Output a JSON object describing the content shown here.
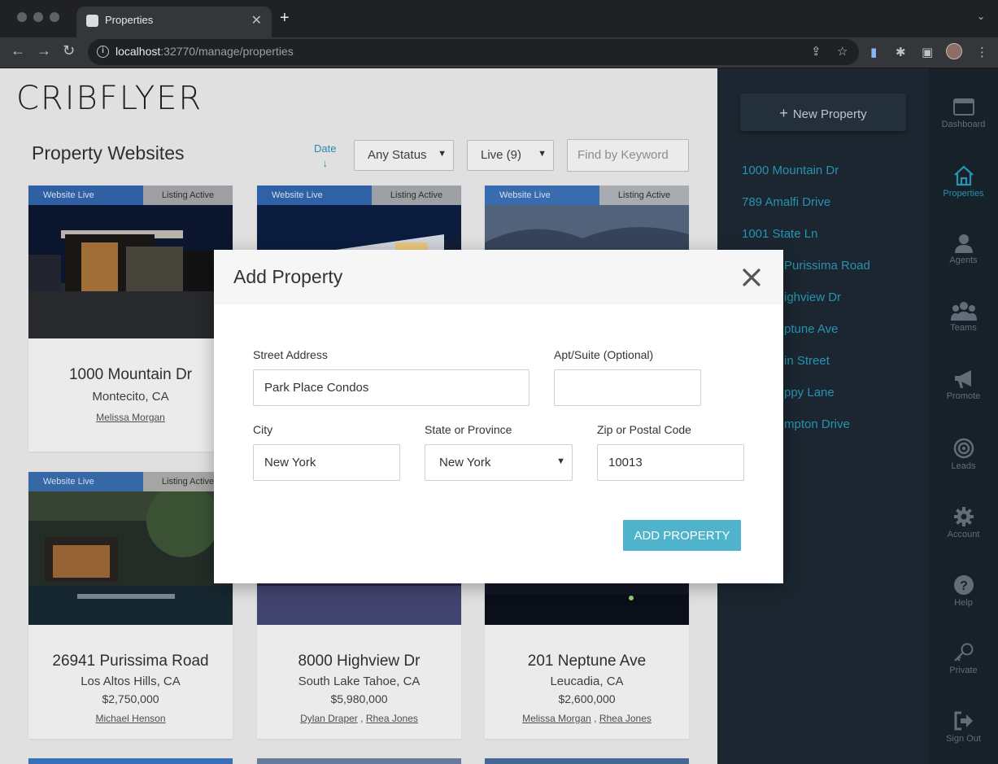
{
  "browser": {
    "tab_title": "Properties",
    "url_host": "localhost",
    "url_path": ":32770/manage/properties"
  },
  "app": {
    "logo": "CRIBFLYER",
    "page_title": "Property Websites",
    "sort": {
      "label": "Date",
      "arrow": "↓"
    },
    "status_filter": "Any Status",
    "live_filter": "Live (9)",
    "keyword_placeholder": "Find by Keyword"
  },
  "cards": [
    {
      "badge_left": "Website Live",
      "badge_right": "Listing Active",
      "address": "1000 Mountain Dr",
      "city": "Montecito, CA",
      "price": "",
      "agents": [
        "Melissa Morgan"
      ]
    },
    {
      "badge_left": "Website Live",
      "badge_right": "Listing Active",
      "address": "",
      "city": "",
      "price": "",
      "agents": []
    },
    {
      "badge_left": "Website Live",
      "badge_right": "Listing Active",
      "address": "",
      "city": "",
      "price": "",
      "agents": []
    },
    {
      "badge_left": "Website Live",
      "badge_right": "Listing Active",
      "address": "26941 Purissima Road",
      "city": "Los Altos Hills, CA",
      "price": "$2,750,000",
      "agents": [
        "Michael Henson"
      ]
    },
    {
      "badge_left": "",
      "badge_right": "",
      "address": "8000 Highview Dr",
      "city": "South Lake Tahoe, CA",
      "price": "$5,980,000",
      "agents": [
        "Dylan Draper",
        "Rhea Jones"
      ]
    },
    {
      "badge_left": "",
      "badge_right": "",
      "address": "201 Neptune Ave",
      "city": "Leucadia, CA",
      "price": "$2,600,000",
      "agents": [
        "Melissa Morgan",
        "Rhea Jones"
      ]
    }
  ],
  "agent_separator": ",",
  "right_panel": {
    "new_button_icon": "+",
    "new_button": "New Property",
    "properties": [
      "1000 Mountain Dr",
      "789 Amalfi Drive",
      "1001 State Ln",
      "Purissima Road",
      "ighview Dr",
      "ptune Ave",
      "in Street",
      "ppy Lane",
      "mpton Drive"
    ]
  },
  "icon_nav": [
    {
      "label": "Dashboard",
      "icon": "dashboard-icon",
      "active": false
    },
    {
      "label": "Properties",
      "icon": "home-icon",
      "active": true
    },
    {
      "label": "Agents",
      "icon": "person-icon",
      "active": false
    },
    {
      "label": "Teams",
      "icon": "group-icon",
      "active": false
    },
    {
      "label": "Promote",
      "icon": "megaphone-icon",
      "active": false
    },
    {
      "label": "Leads",
      "icon": "target-icon",
      "active": false
    },
    {
      "label": "Account",
      "icon": "gear-icon",
      "active": false
    },
    {
      "label": "Help",
      "icon": "help-icon",
      "active": false
    },
    {
      "label": "Private",
      "icon": "key-icon",
      "active": false
    },
    {
      "label": "Sign Out",
      "icon": "sign-out-icon",
      "active": false
    }
  ],
  "modal": {
    "title": "Add Property",
    "fields": {
      "street": {
        "label": "Street Address",
        "value": "Park Place Condos"
      },
      "apt": {
        "label": "Apt/Suite (Optional)",
        "value": ""
      },
      "city": {
        "label": "City",
        "value": "New York"
      },
      "state": {
        "label": "State or Province",
        "value": "New York"
      },
      "zip": {
        "label": "Zip or Postal Code",
        "value": "10013"
      }
    },
    "submit": "ADD PROPERTY"
  },
  "colors": {
    "accent": "#2b9fc0",
    "button": "#4fb3cc",
    "panel": "#1e2a35",
    "iconbar": "#1a242e"
  }
}
